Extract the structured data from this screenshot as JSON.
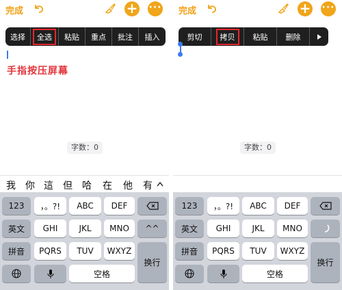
{
  "left": {
    "topbar": {
      "done_label": "完成"
    },
    "menu": {
      "items": [
        "选择",
        "全选",
        "粘贴",
        "重点",
        "批注",
        "插入"
      ],
      "highlighted": "全选"
    },
    "hint_text": "手指按压屏幕",
    "word_count": "字数：0",
    "candidates": [
      "我",
      "你",
      "這",
      "但",
      "哈",
      "在",
      "他",
      "有"
    ],
    "keyboard": {
      "row1": [
        "123",
        "，。?!",
        "ABC",
        "DEF"
      ],
      "row2": [
        "英文",
        "GHI",
        "JKL",
        "MNO",
        "^^"
      ],
      "row3": [
        "拼音",
        "PQRS",
        "TUV",
        "WXYZ"
      ],
      "enter_label": "换行",
      "space_label": "空格"
    }
  },
  "right": {
    "topbar": {
      "done_label": "完成"
    },
    "menu": {
      "items": [
        "剪切",
        "拷贝",
        "粘贴",
        "删除"
      ],
      "highlighted": "拷贝"
    },
    "word_count": "字数：0",
    "keyboard": {
      "row1": [
        "123",
        "，。?!",
        "ABC",
        "DEF"
      ],
      "row2": [
        "英文",
        "GHI",
        "JKL",
        "MNO"
      ],
      "row3": [
        "拼音",
        "PQRS",
        "TUV",
        "WXYZ"
      ],
      "enter_label": "换行",
      "space_label": "空格"
    }
  },
  "colors": {
    "accent": "#f0a51a",
    "highlight_box": "#e8262d",
    "hint_text": "#e2353b",
    "selection": "#3a7bf0"
  }
}
